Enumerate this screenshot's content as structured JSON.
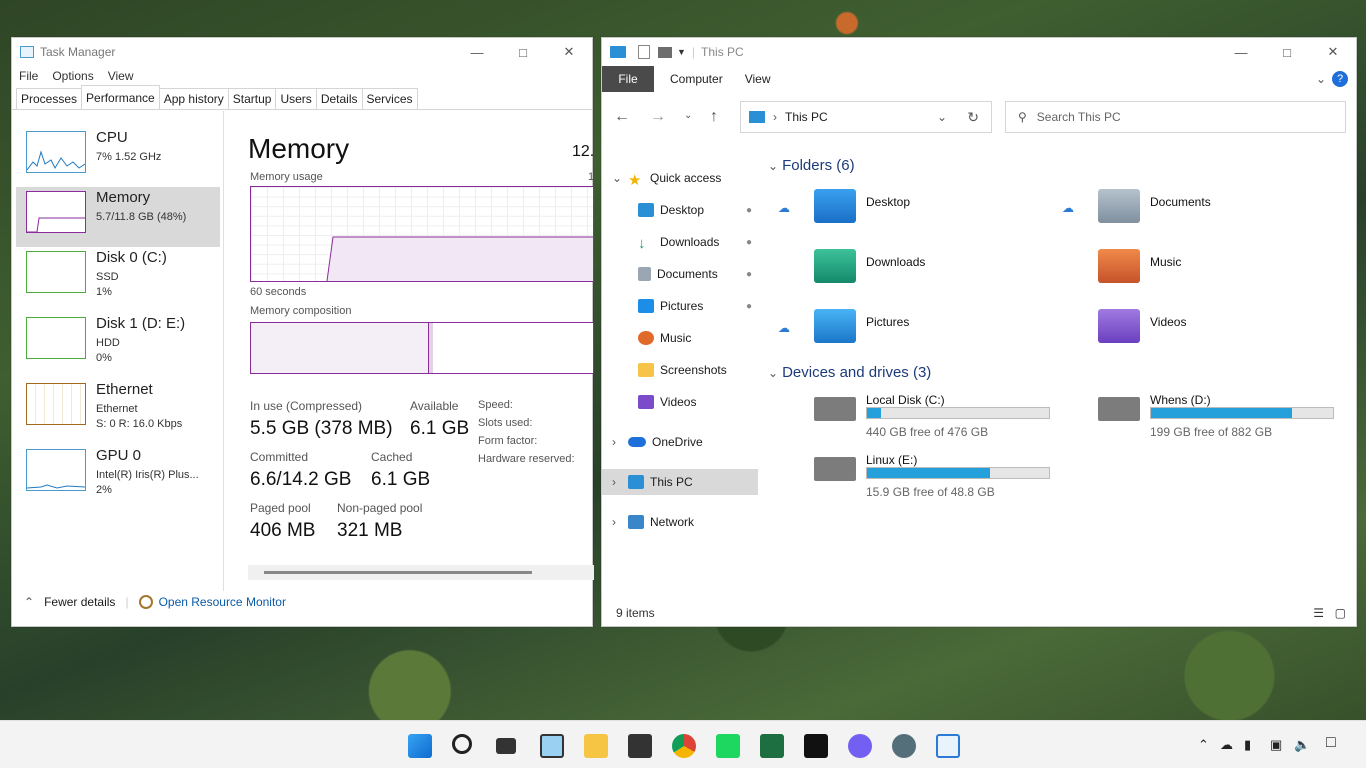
{
  "task_manager": {
    "title": "Task Manager",
    "menu": [
      "File",
      "Options",
      "View"
    ],
    "tabs": [
      "Processes",
      "Performance",
      "App history",
      "Startup",
      "Users",
      "Details",
      "Services"
    ],
    "sidebar": [
      {
        "name": "CPU",
        "line1": "7%  1.52 GHz",
        "line2": ""
      },
      {
        "name": "Memory",
        "line1": "5.7/11.8 GB (48%)",
        "line2": ""
      },
      {
        "name": "Disk 0 (C:)",
        "line1": "SSD",
        "line2": "1%"
      },
      {
        "name": "Disk 1 (D: E:)",
        "line1": "HDD",
        "line2": "0%"
      },
      {
        "name": "Ethernet",
        "line1": "Ethernet",
        "line2": "S: 0  R: 16.0 Kbps"
      },
      {
        "name": "GPU 0",
        "line1": "Intel(R) Iris(R) Plus...",
        "line2": "2%"
      }
    ],
    "main": {
      "title": "Memory",
      "total": "12.",
      "usage_label": "Memory usage",
      "usage_right": "1",
      "seconds": "60 seconds",
      "composition_label": "Memory composition",
      "in_use_label": "In use (Compressed)",
      "in_use": "5.5 GB (378 MB)",
      "available_label": "Available",
      "available": "6.1 GB",
      "committed_label": "Committed",
      "committed": "6.6/14.2 GB",
      "cached_label": "Cached",
      "cached": "6.1 GB",
      "paged_label": "Paged pool",
      "paged": "406 MB",
      "nonpaged_label": "Non-paged pool",
      "nonpaged": "321 MB",
      "speed": "Speed:",
      "slots": "Slots used:",
      "form": "Form factor:",
      "hwres": "Hardware reserved:"
    },
    "footer": {
      "fewer": "Fewer details",
      "monitor": "Open Resource Monitor"
    }
  },
  "explorer": {
    "title": "This PC",
    "ribbon": [
      "File",
      "Computer",
      "View"
    ],
    "address": "This PC",
    "search_placeholder": "Search This PC",
    "tree": [
      "Quick access",
      "Desktop",
      "Downloads",
      "Documents",
      "Pictures",
      "Music",
      "Screenshots",
      "Videos",
      "OneDrive",
      "This PC",
      "Network"
    ],
    "folders_header": "Folders (6)",
    "folders": [
      "Desktop",
      "Documents",
      "Downloads",
      "Music",
      "Pictures",
      "Videos"
    ],
    "devices_header": "Devices and drives (3)",
    "drives": [
      {
        "name": "Local Disk (C:)",
        "free": "440 GB free of 476 GB",
        "used_fraction": 0.076
      },
      {
        "name": "Whens (D:)",
        "free": "199 GB free of 882 GB",
        "used_fraction": 0.774
      },
      {
        "name": "Linux (E:)",
        "free": "15.9 GB free of 48.8 GB",
        "used_fraction": 0.674
      }
    ],
    "status": "9 items"
  }
}
